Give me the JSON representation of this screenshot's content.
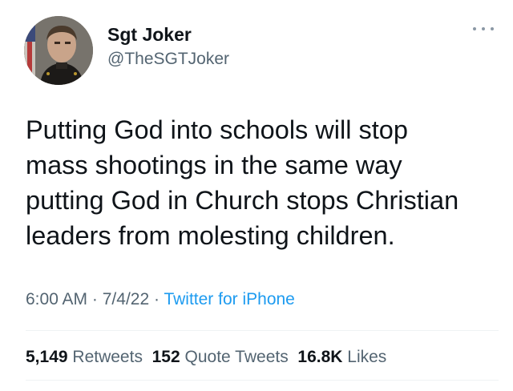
{
  "author": {
    "display_name": "Sgt Joker",
    "handle": "@TheSGTJoker",
    "avatar_icon": "profile-photo"
  },
  "tweet": {
    "text": "Putting God into schools will stop\nmass shootings in the same way\nputting God in Church stops Christian\nleaders from molesting children."
  },
  "meta": {
    "time": "6:00 AM",
    "date": "7/4/22",
    "separator": "·",
    "source": "Twitter for iPhone"
  },
  "stats": {
    "retweets_count": "5,149",
    "retweets_label": "Retweets",
    "quote_count": "152",
    "quote_label": "Quote Tweets",
    "likes_count": "16.8K",
    "likes_label": "Likes"
  },
  "colors": {
    "link": "#1d9bf0",
    "secondary_text": "#536471",
    "primary_text": "#0f1419"
  }
}
